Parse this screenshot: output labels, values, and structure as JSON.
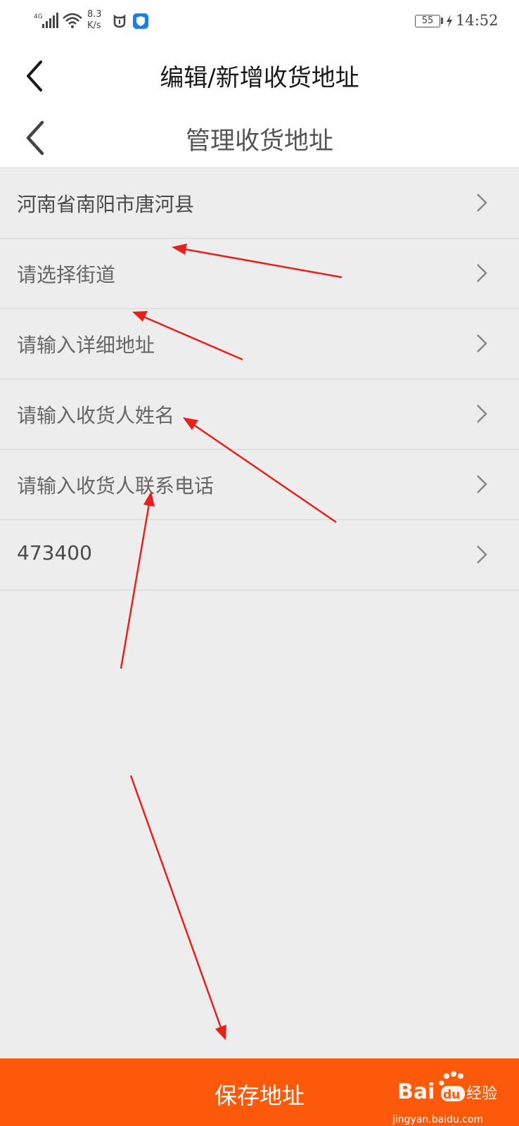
{
  "status_bar": {
    "network": "4G",
    "speed_value": "8.3",
    "speed_unit": "K/s",
    "battery": "55",
    "time": "14:52"
  },
  "header_primary": {
    "title": "编辑/新增收货地址"
  },
  "header_secondary": {
    "title": "管理收货地址"
  },
  "form_rows": [
    {
      "text": "河南省南阳市唐河县"
    },
    {
      "text": "请选择街道"
    },
    {
      "text": "请输入详细地址"
    },
    {
      "text": "请输入收货人姓名"
    },
    {
      "text": "请输入收货人联系电话"
    },
    {
      "text": "473400"
    }
  ],
  "save_button": {
    "label": "保存地址"
  },
  "watermark": {
    "logo_text": "Bai du 经验",
    "site": "jingyan.baidu.com"
  },
  "colors": {
    "accent": "#fc5a0a",
    "annotation_arrow": "#e8201c",
    "background": "#ededed"
  }
}
